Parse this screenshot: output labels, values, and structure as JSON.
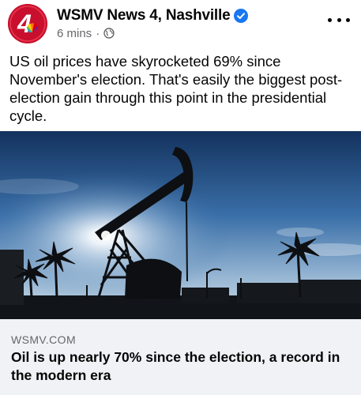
{
  "post": {
    "page_name": "WSMV News 4, Nashville",
    "timestamp": "6 mins",
    "meta_separator": "·",
    "privacy_icon": "globe-icon",
    "verified_icon": "verified-badge-icon",
    "avatar_label": "4",
    "text": "US oil prices have skyrocketed 69% since November's election. That's easily the biggest post-election gain through this point in the presidential cycle."
  },
  "link_preview": {
    "image_subject": "oil pump jack silhouette against sky with palm trees",
    "domain": "WSMV.COM",
    "headline": "Oil is up nearly 70% since the election, a record in the modern era"
  },
  "colors": {
    "brand_red": "#c8102e",
    "verified_blue": "#1877f2",
    "secondary_text": "#65676b",
    "footer_bg": "#f0f2f5"
  }
}
